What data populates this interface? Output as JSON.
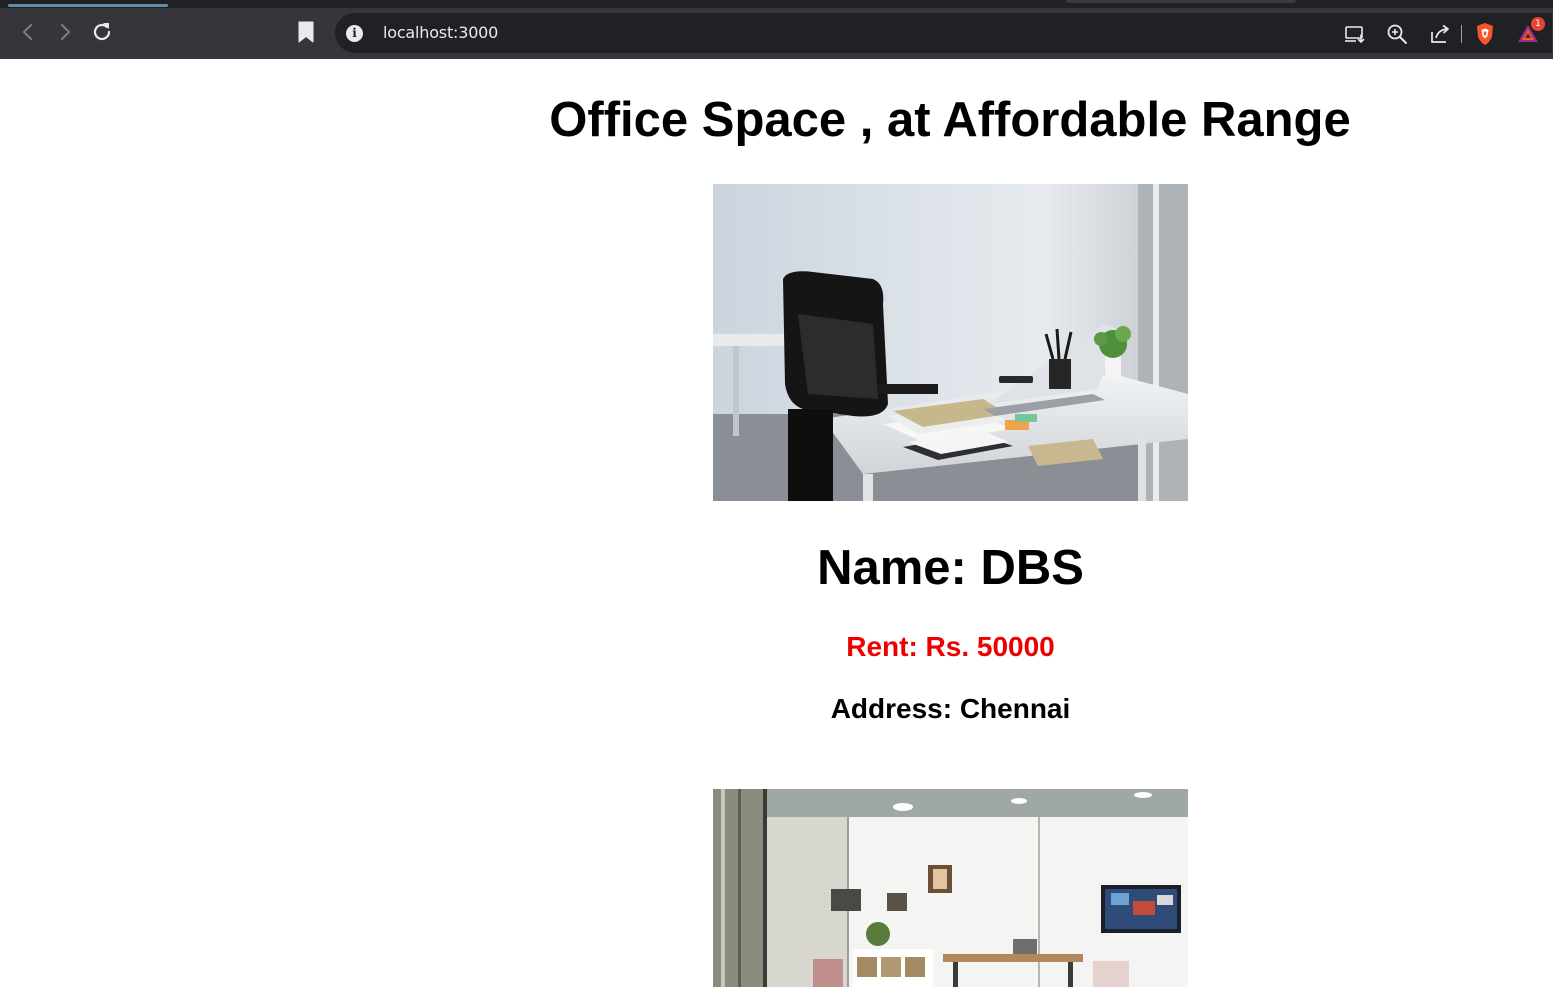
{
  "browser": {
    "url": "localhost:3000",
    "notification_count": "1",
    "icons": {
      "back": "back-arrow-icon",
      "forward": "forward-arrow-icon",
      "reload": "reload-icon",
      "bookmark": "bookmark-icon",
      "site_info": "info-icon",
      "install": "install-app-icon",
      "zoom": "zoom-icon",
      "share": "share-icon",
      "brave_shields": "brave-shields-icon",
      "brave_rewards": "brave-rewards-icon"
    },
    "colors": {
      "chrome": "#35363a",
      "omnibox": "#202124",
      "badge": "#e8442f"
    }
  },
  "page": {
    "title": "Office Space , at Affordable Range",
    "listings": [
      {
        "image": "office-desk-chair-photo",
        "name": "Name: DBS",
        "rent": "Rent: Rs. 50000",
        "address": "Address: Chennai"
      },
      {
        "image": "office-room-photo"
      }
    ],
    "colors": {
      "rent": "#ee0000",
      "text": "#000000"
    }
  }
}
